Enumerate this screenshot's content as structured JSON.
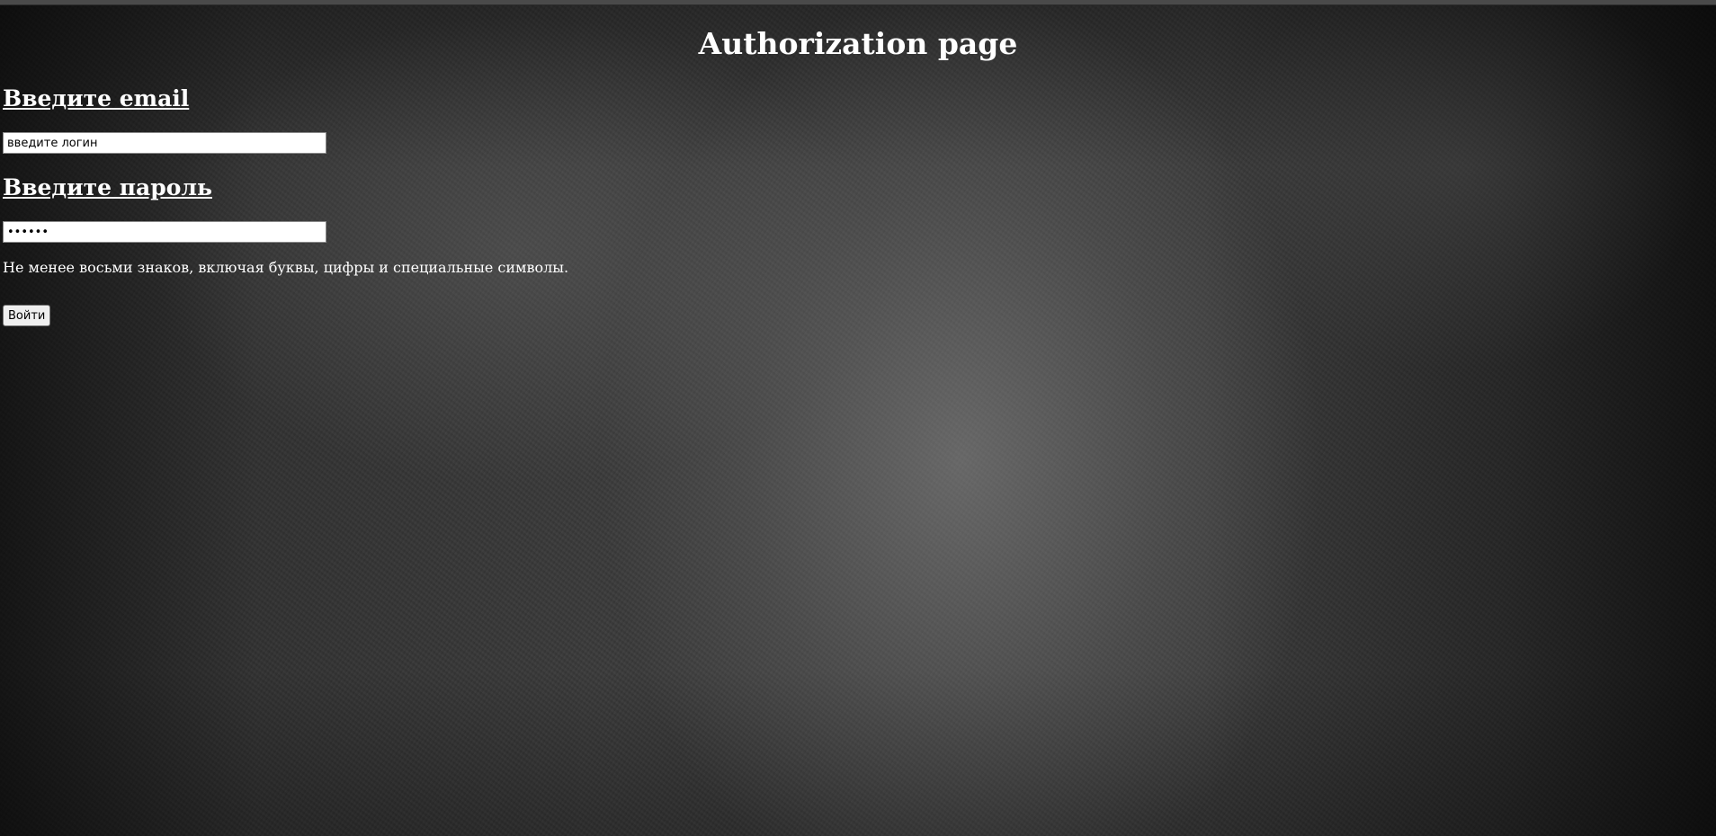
{
  "page": {
    "title": "Authorization page"
  },
  "form": {
    "email_label": "Введите email",
    "email_value": "введите логин",
    "password_label": "Введите пароль",
    "password_value": "123456",
    "password_hint": "Не менее восьми знаков, включая буквы, цифры и специальные символы.",
    "submit_label": "Войти"
  },
  "colors": {
    "text": "#ffffff",
    "background": "#3a3a3a"
  }
}
